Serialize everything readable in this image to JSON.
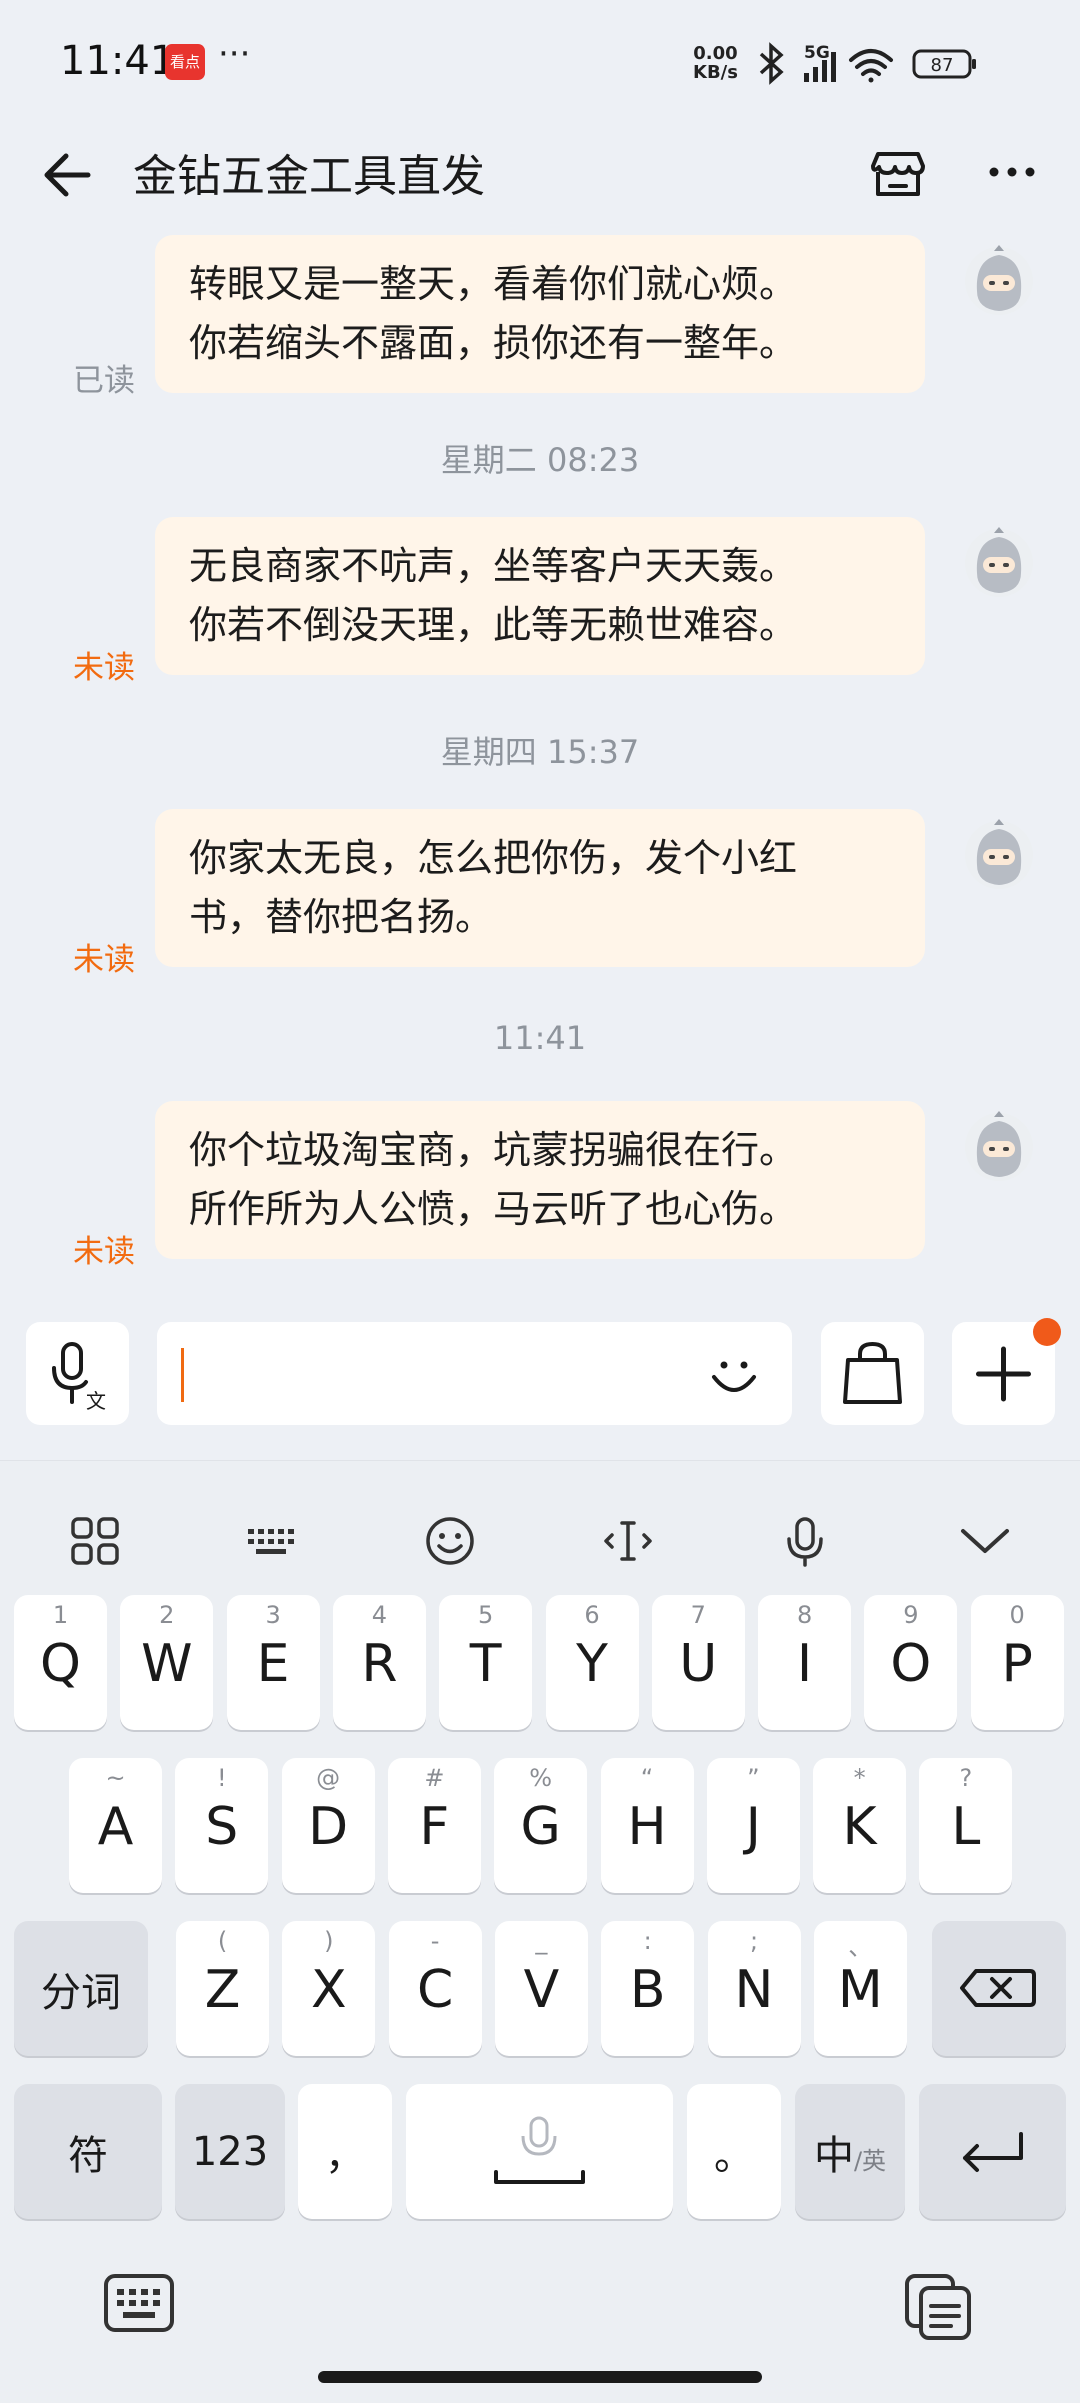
{
  "status_bar": {
    "time": "11:41",
    "app_badge": "看点",
    "more": "···",
    "net_speed_value": "0.00",
    "net_speed_unit": "KB/s",
    "network": "5G",
    "battery": "87"
  },
  "header": {
    "title": "金钻五金工具直发"
  },
  "messages": [
    {
      "line1": "转眼又是一整天，看着你们就心烦。",
      "line2": "你若缩头不露面，损你还有一整年。",
      "status": "已读"
    },
    {
      "line1": "无良商家不吭声，坐等客户天天轰。",
      "line2": "你若不倒没天理，此等无赖世难容。",
      "status": "未读"
    },
    {
      "line1": "你家太无良，怎么把你伤，发个小红",
      "line2": "书，替你把名扬。",
      "status": "未读"
    },
    {
      "line1": "你个垃圾淘宝商，坑蒙拐骗很在行。",
      "line2": "所作所为人公愤，马云听了也心伤。",
      "status": "未读"
    }
  ],
  "timestamps": [
    "星期二 08:23",
    "星期四 15:37",
    "11:41"
  ],
  "keyboard": {
    "row1": [
      {
        "hint": "1",
        "key": "Q"
      },
      {
        "hint": "2",
        "key": "W"
      },
      {
        "hint": "3",
        "key": "E"
      },
      {
        "hint": "4",
        "key": "R"
      },
      {
        "hint": "5",
        "key": "T"
      },
      {
        "hint": "6",
        "key": "Y"
      },
      {
        "hint": "7",
        "key": "U"
      },
      {
        "hint": "8",
        "key": "I"
      },
      {
        "hint": "9",
        "key": "O"
      },
      {
        "hint": "0",
        "key": "P"
      }
    ],
    "row2": [
      {
        "hint": "~",
        "key": "A"
      },
      {
        "hint": "!",
        "key": "S"
      },
      {
        "hint": "@",
        "key": "D"
      },
      {
        "hint": "#",
        "key": "F"
      },
      {
        "hint": "%",
        "key": "G"
      },
      {
        "hint": "“",
        "key": "H"
      },
      {
        "hint": "”",
        "key": "J"
      },
      {
        "hint": "*",
        "key": "K"
      },
      {
        "hint": "?",
        "key": "L"
      }
    ],
    "row3": [
      {
        "hint": "(",
        "key": "Z"
      },
      {
        "hint": ")",
        "key": "X"
      },
      {
        "hint": "-",
        "key": "C"
      },
      {
        "hint": "_",
        "key": "V"
      },
      {
        "hint": ":",
        "key": "B"
      },
      {
        "hint": ";",
        "key": "N"
      },
      {
        "hint": "、",
        "key": "M"
      }
    ],
    "fenci": "分词",
    "fu": "符",
    "num": "123",
    "comma": "，",
    "period": "。",
    "lang_main": "中",
    "lang_sub": "/英"
  }
}
